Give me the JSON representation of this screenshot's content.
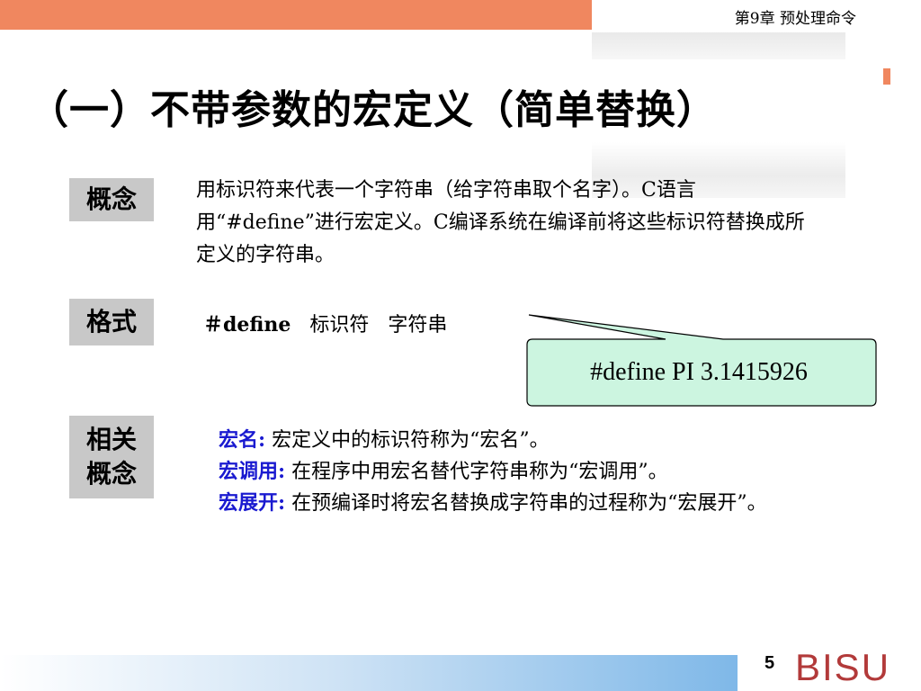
{
  "header": {
    "chapter": "第9章  预处理命令"
  },
  "title": "（一）不带参数的宏定义（简单替换）",
  "concept": {
    "label": "概念",
    "text": "用标识符来代表一个字符串（给字符串取个名字）。C语言用“#define”进行宏定义。C编译系统在编译前将这些标识符替换成所定义的字符串。"
  },
  "format": {
    "label": "格式",
    "symbol": "＃define",
    "ident": "标识符",
    "string": "字符串"
  },
  "callout": {
    "text": "#define  PI  3.1415926"
  },
  "related": {
    "label_line1": "相关",
    "label_line2": "概念",
    "items": [
      {
        "term": "宏名:",
        "desc": "   宏定义中的标识符称为“宏名”。"
      },
      {
        "term": "宏调用:",
        "desc": " 在程序中用宏名替代字符串称为“宏调用”。"
      },
      {
        "term": "宏展开:",
        "desc": " 在预编译时将宏名替换成字符串的过程称为“宏展开”。"
      }
    ]
  },
  "footer": {
    "page": "5",
    "logo": "BISU"
  },
  "colors": {
    "accent": "#f0875f",
    "term": "#1a1ad0",
    "callout_fill": "#ccf5e0",
    "label_bg": "#c8c8c8",
    "logo": "#b23a3a"
  }
}
